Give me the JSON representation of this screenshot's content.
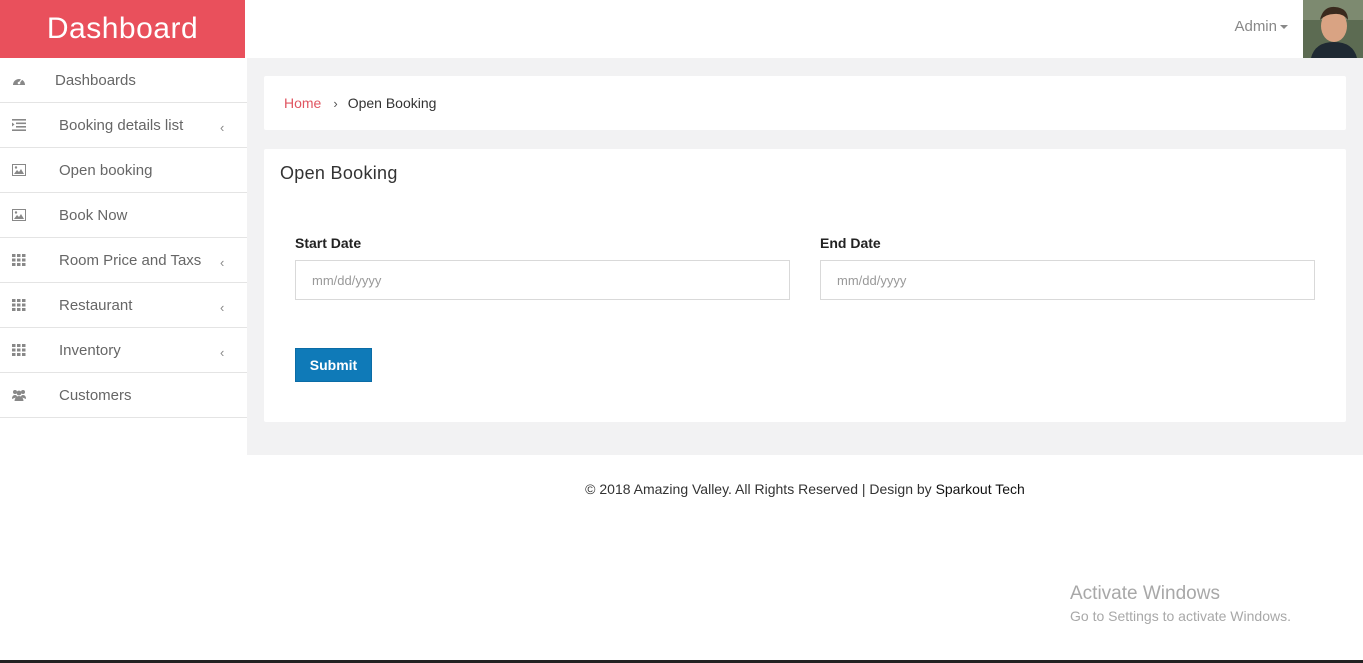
{
  "header": {
    "brand": "Dashboard",
    "user_menu_label": "Admin"
  },
  "sidebar": {
    "items": [
      {
        "label": "Dashboards",
        "icon": "tachometer-icon",
        "has_submenu": false
      },
      {
        "label": "Booking details list",
        "icon": "list-indent-icon",
        "has_submenu": true
      },
      {
        "label": "Open booking",
        "icon": "image-icon",
        "has_submenu": false
      },
      {
        "label": "Book Now",
        "icon": "image-icon",
        "has_submenu": false
      },
      {
        "label": "Room Price and Taxs",
        "icon": "grid-icon",
        "has_submenu": true
      },
      {
        "label": "Restaurant",
        "icon": "grid-icon",
        "has_submenu": true
      },
      {
        "label": "Inventory",
        "icon": "grid-icon",
        "has_submenu": true
      },
      {
        "label": "Customers",
        "icon": "users-icon",
        "has_submenu": false
      }
    ]
  },
  "breadcrumb": {
    "home": "Home",
    "current": "Open Booking"
  },
  "form": {
    "title": "Open Booking",
    "start_label": "Start Date",
    "start_placeholder": "mm/dd/yyyy",
    "end_label": "End Date",
    "end_placeholder": "mm/dd/yyyy",
    "submit_label": "Submit"
  },
  "footer": {
    "text": "© 2018 Amazing Valley. All Rights Reserved | Design by ",
    "link": "Sparkout Tech"
  },
  "watermark": {
    "title": "Activate Windows",
    "subtitle": "Go to Settings to activate Windows."
  },
  "colors": {
    "brand": "#e9505c",
    "link": "#e05561",
    "primary_button": "#0f7ab8",
    "content_bg": "#f2f2f3"
  }
}
